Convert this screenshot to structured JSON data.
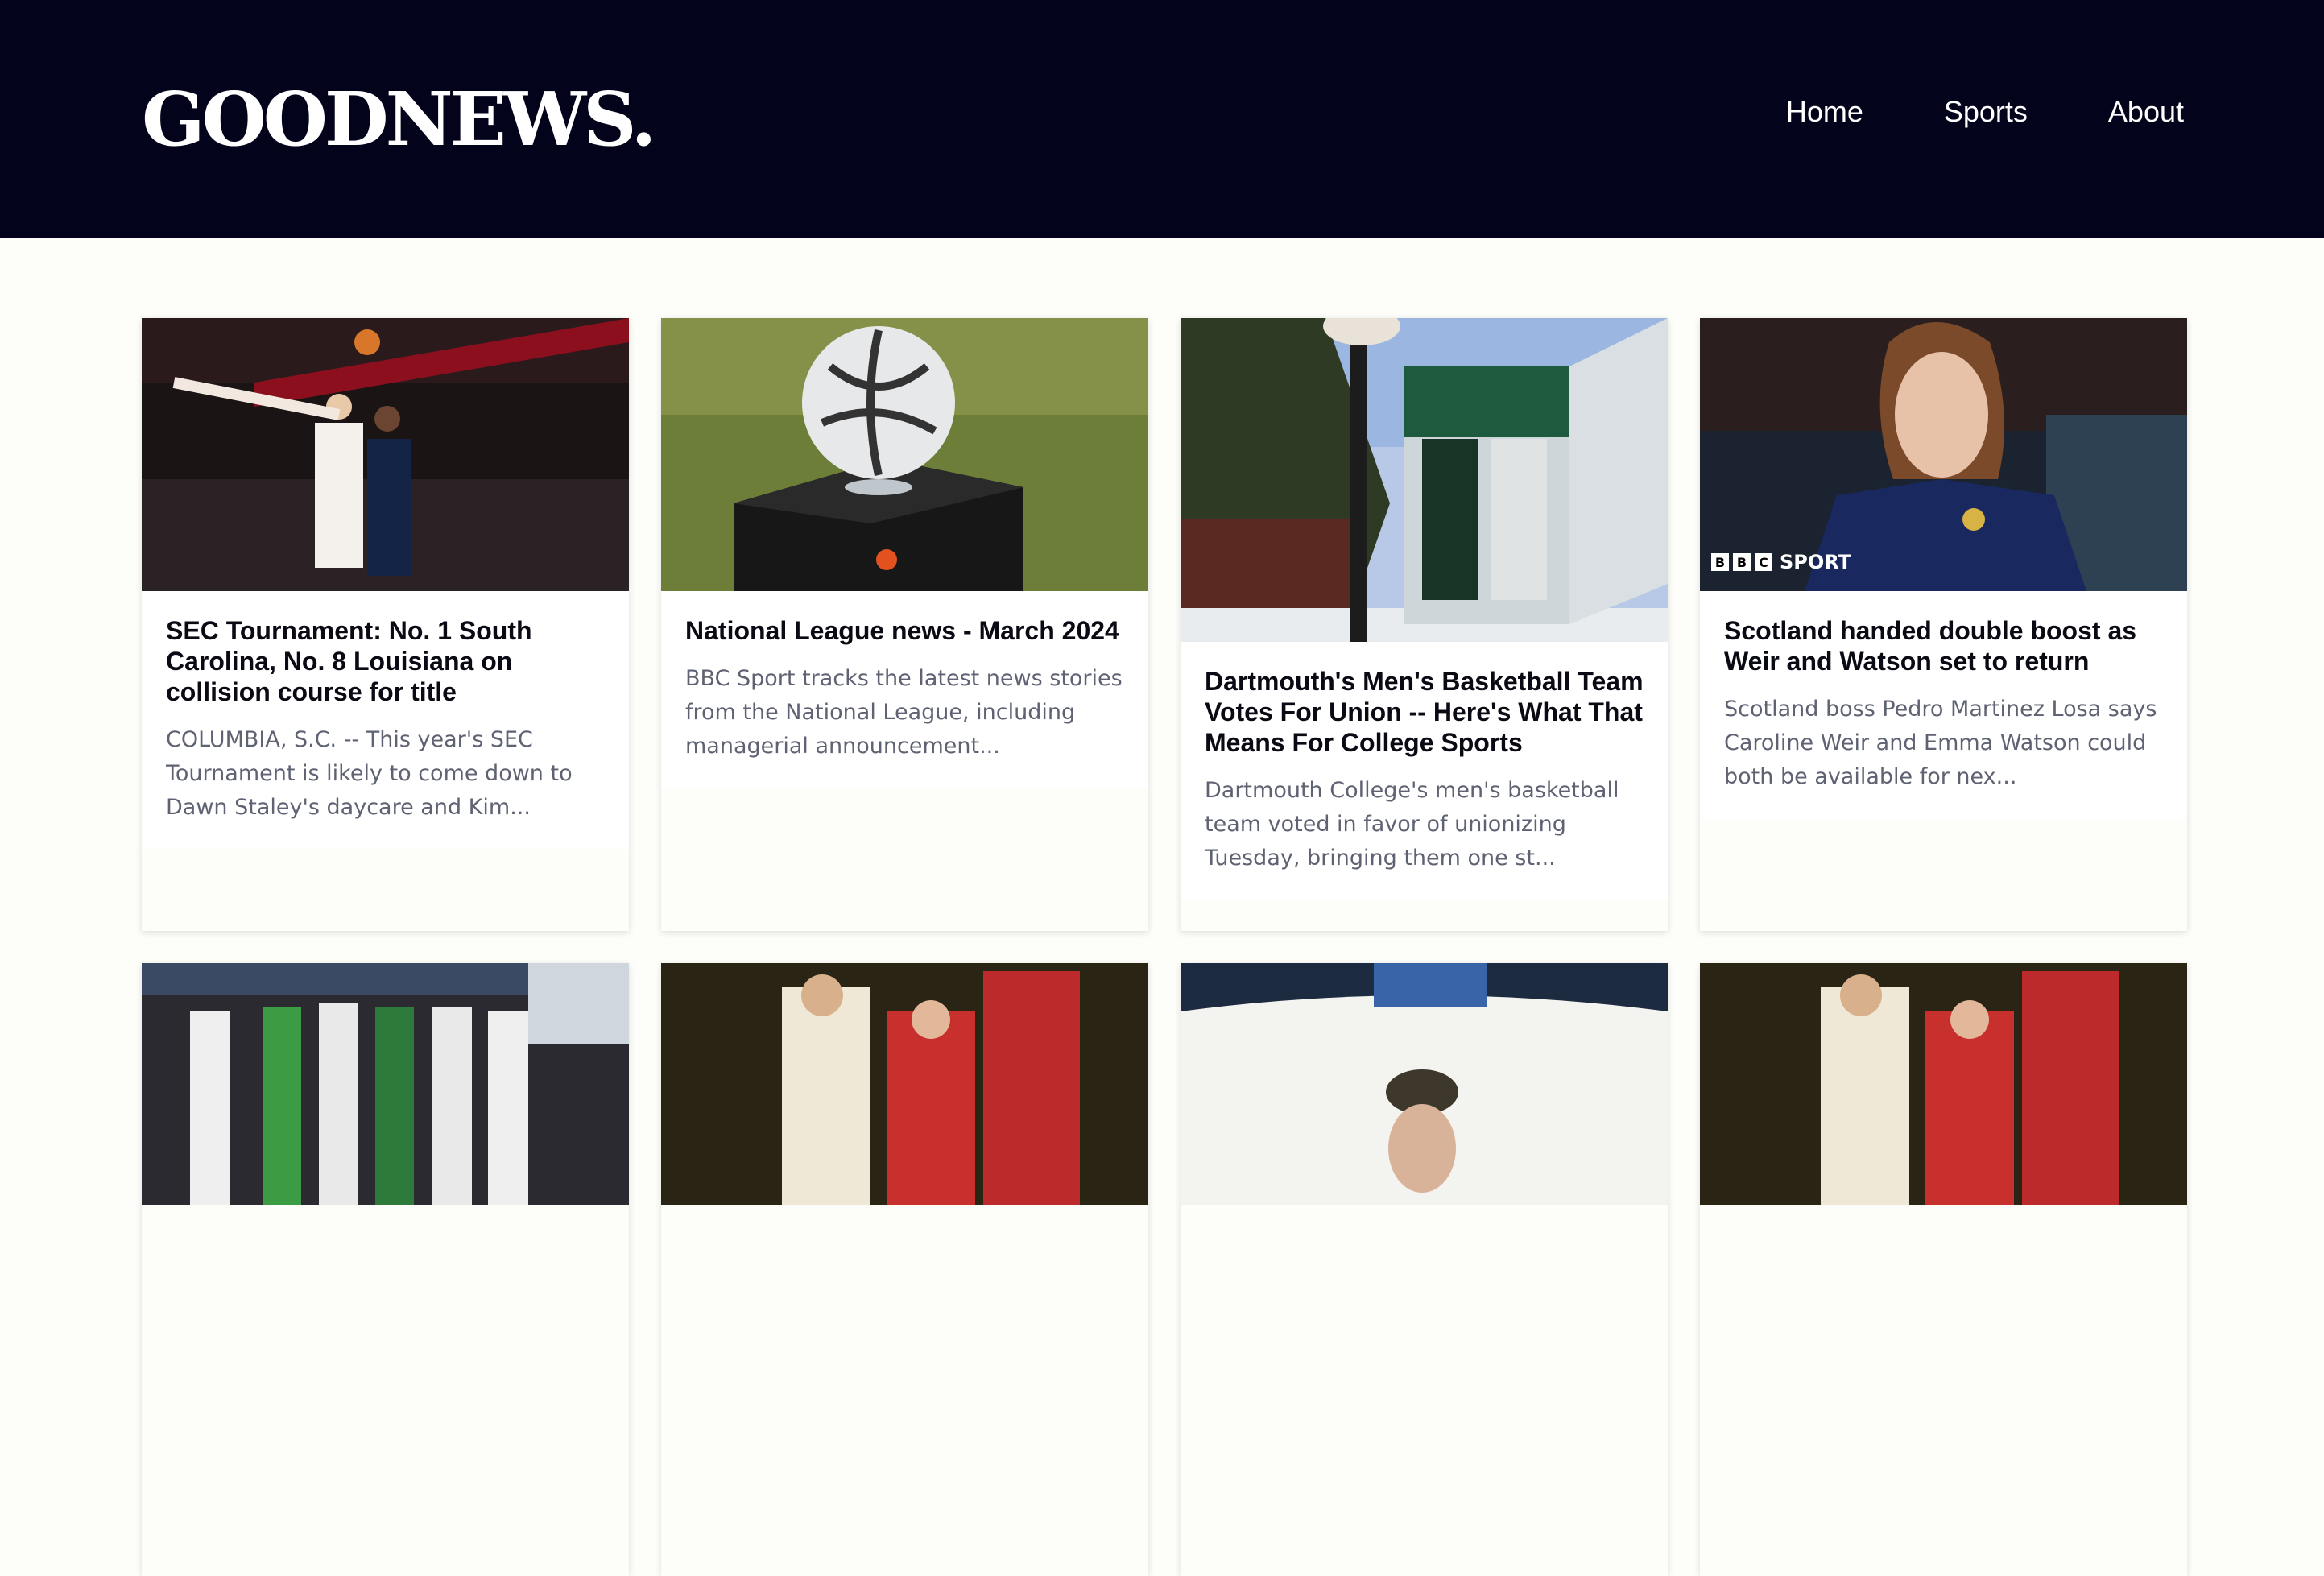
{
  "site": {
    "logo": "GOODNEWS."
  },
  "nav": {
    "items": [
      "Home",
      "Sports",
      "About"
    ]
  },
  "articles": [
    {
      "title": "SEC Tournament: No. 1 South Carolina, No. 8 Louisiana on collision course for title",
      "excerpt": "COLUMBIA, S.C. -- This year's SEC Tournament is likely to come down to Dawn Staley's daycare and Kim..."
    },
    {
      "title": "National League news - March 2024",
      "excerpt": "BBC Sport tracks the latest news stories from the National League, including managerial announcement..."
    },
    {
      "title": "Dartmouth's Men's Basketball Team Votes For Union -- Here's What That Means For College Sports",
      "excerpt": "Dartmouth College's men's basketball team voted in favor of unionizing Tuesday, bringing them one st..."
    },
    {
      "title": "Scotland handed double boost as Weir and Watson set to return",
      "excerpt": "Scotland boss Pedro Martinez Losa says Caroline Weir and Emma Watson could both be available for nex...",
      "badge": {
        "letters": [
          "B",
          "B",
          "C"
        ],
        "label": "SPORT"
      }
    }
  ]
}
